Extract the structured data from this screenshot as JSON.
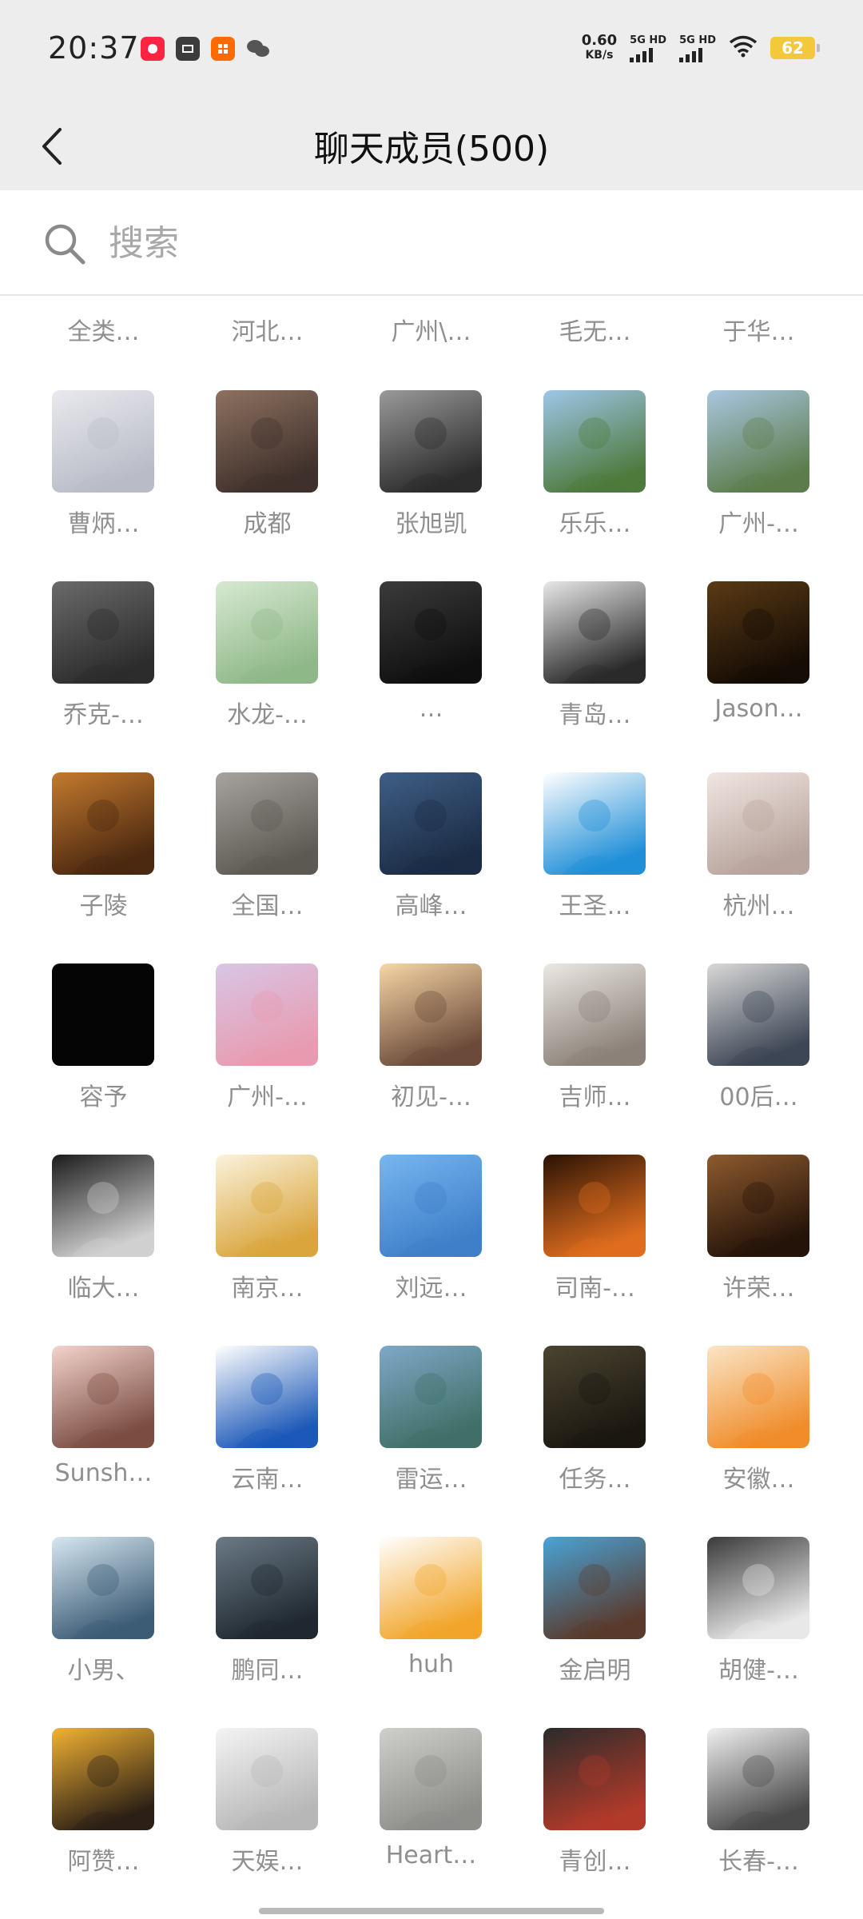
{
  "status_bar": {
    "time": "20:37",
    "net_speed_value": "0.60",
    "net_speed_unit": "KB/s",
    "sim1_label": "5G HD",
    "sim2_label": "5G HD",
    "battery": "62",
    "app_icons": [
      "xiaohongshu-icon",
      "message-icon",
      "taobao-icon",
      "wechat-icon"
    ]
  },
  "header": {
    "title": "聊天成员(500)",
    "back_icon": "chevron-left-icon"
  },
  "search": {
    "placeholder": "搜索"
  },
  "partial_row": [
    "全类…",
    "河北…",
    "广州\\…",
    "毛无…",
    "于华…"
  ],
  "members": [
    {
      "name": "曹炳…",
      "avatar_desc": "anime-white-hair",
      "colors": [
        "#e9e9ee",
        "#b9bcc7"
      ]
    },
    {
      "name": "成都",
      "avatar_desc": "couple-sunset",
      "colors": [
        "#8d7160",
        "#3f302b"
      ]
    },
    {
      "name": "张旭凯",
      "avatar_desc": "hooded-figure",
      "colors": [
        "#9a9a9a",
        "#2c2c2c"
      ]
    },
    {
      "name": "乐乐…",
      "avatar_desc": "dinosaur-statue",
      "colors": [
        "#9ec6e8",
        "#4e7a3c"
      ]
    },
    {
      "name": "广州-…",
      "avatar_desc": "mountain-landscape",
      "colors": [
        "#a9c6e0",
        "#5c7d4b"
      ]
    },
    {
      "name": "乔克-…",
      "avatar_desc": "sleeping-boy",
      "colors": [
        "#6a6a6a",
        "#2c2c2c"
      ]
    },
    {
      "name": "水龙-…",
      "avatar_desc": "cartoon-boy",
      "colors": [
        "#d7e9d1",
        "#8fb889"
      ]
    },
    {
      "name": "…",
      "avatar_desc": "dark-silhouette",
      "colors": [
        "#3b3b3b",
        "#0f0f0f"
      ]
    },
    {
      "name": "青岛…",
      "avatar_desc": "man-with-cat",
      "colors": [
        "#e8e8e8",
        "#2a2a2a"
      ]
    },
    {
      "name": "Jason…",
      "avatar_desc": "dark-painting",
      "colors": [
        "#5a3a14",
        "#150c05"
      ]
    },
    {
      "name": "子陵",
      "avatar_desc": "beer-glass",
      "colors": [
        "#c47a2e",
        "#4b2810"
      ]
    },
    {
      "name": "全国…",
      "avatar_desc": "person-on-ground",
      "colors": [
        "#a7a39e",
        "#5c5852"
      ]
    },
    {
      "name": "高峰…",
      "avatar_desc": "sea-figure",
      "colors": [
        "#3f5e86",
        "#1b2c44"
      ]
    },
    {
      "name": "王圣…",
      "avatar_desc": "doraemon",
      "colors": [
        "#ffffff",
        "#1f8fd8"
      ]
    },
    {
      "name": "杭州…",
      "avatar_desc": "little-girl",
      "colors": [
        "#f1e6e2",
        "#b7a49c"
      ]
    },
    {
      "name": "容予",
      "avatar_desc": "black-square",
      "colors": [
        "#050505",
        "#050505"
      ]
    },
    {
      "name": "广州-…",
      "avatar_desc": "cartoon-patrick",
      "colors": [
        "#d8c6e6",
        "#e89bb0"
      ]
    },
    {
      "name": "初见-…",
      "avatar_desc": "anime-father-daughter",
      "colors": [
        "#f7d6a6",
        "#6b4a3a"
      ]
    },
    {
      "name": "吉师…",
      "avatar_desc": "couple-sitting",
      "colors": [
        "#ece8e4",
        "#8b8178"
      ]
    },
    {
      "name": "00后…",
      "avatar_desc": "person-dark-jacket",
      "colors": [
        "#d9d9d9",
        "#3d4654"
      ]
    },
    {
      "name": "临大…",
      "avatar_desc": "lindaxiaoge-logo",
      "colors": [
        "#1b1b1b",
        "#d0d0d0"
      ]
    },
    {
      "name": "南京…",
      "avatar_desc": "gold-badge",
      "colors": [
        "#fbf3dc",
        "#d9a53c"
      ]
    },
    {
      "name": "刘远…",
      "avatar_desc": "cartoon-boy-blue",
      "colors": [
        "#77b6ef",
        "#3f7fc9"
      ]
    },
    {
      "name": "司南-…",
      "avatar_desc": "fire-emblem",
      "colors": [
        "#2a1204",
        "#e06d1e"
      ]
    },
    {
      "name": "许荣…",
      "avatar_desc": "sunset-portrait",
      "colors": [
        "#8e5a2e",
        "#241309"
      ]
    },
    {
      "name": "Sunsh…",
      "avatar_desc": "girl-selfie",
      "colors": [
        "#f3d3cc",
        "#7a4c42"
      ]
    },
    {
      "name": "云南…",
      "avatar_desc": "yunnan-logo",
      "colors": [
        "#ffffff",
        "#1b58b8"
      ]
    },
    {
      "name": "雷运…",
      "avatar_desc": "seaside-pier",
      "colors": [
        "#7fa8c8",
        "#3f6f66"
      ]
    },
    {
      "name": "任务…",
      "avatar_desc": "soldier-portrait",
      "colors": [
        "#4a4430",
        "#1b1710"
      ]
    },
    {
      "name": "安徽…",
      "avatar_desc": "cartoon-orange-girl",
      "colors": [
        "#fae5c5",
        "#f08c2a"
      ]
    },
    {
      "name": "小男、",
      "avatar_desc": "ninja-anime",
      "colors": [
        "#d6e7f1",
        "#3c5b75"
      ]
    },
    {
      "name": "鹏同…",
      "avatar_desc": "man-silhouette",
      "colors": [
        "#6b7a86",
        "#1f2830"
      ]
    },
    {
      "name": "huh",
      "avatar_desc": "naruto",
      "colors": [
        "#ffffff",
        "#f2a52a"
      ]
    },
    {
      "name": "金启明",
      "avatar_desc": "anime-boy",
      "colors": [
        "#4aa3d6",
        "#5a3a2c"
      ]
    },
    {
      "name": "胡健-…",
      "avatar_desc": "white-dog",
      "colors": [
        "#3a3a3a",
        "#e8e8e8"
      ]
    },
    {
      "name": "阿赞…",
      "avatar_desc": "sunset-hiker",
      "colors": [
        "#f2b234",
        "#2c2016"
      ]
    },
    {
      "name": "天娱…",
      "avatar_desc": "sketch-couple",
      "colors": [
        "#f4f4f4",
        "#b7b7b7"
      ]
    },
    {
      "name": "Heart…",
      "avatar_desc": "gray-disc",
      "colors": [
        "#cfcfcc",
        "#8d8d8a"
      ]
    },
    {
      "name": "青创…",
      "avatar_desc": "red-car-night",
      "colors": [
        "#2b2b2b",
        "#b23a2a"
      ]
    },
    {
      "name": "长春-…",
      "avatar_desc": "ink-painting-figure",
      "colors": [
        "#f0f0f0",
        "#4a4a4a"
      ]
    }
  ],
  "home_indicator": "gesture-bar"
}
